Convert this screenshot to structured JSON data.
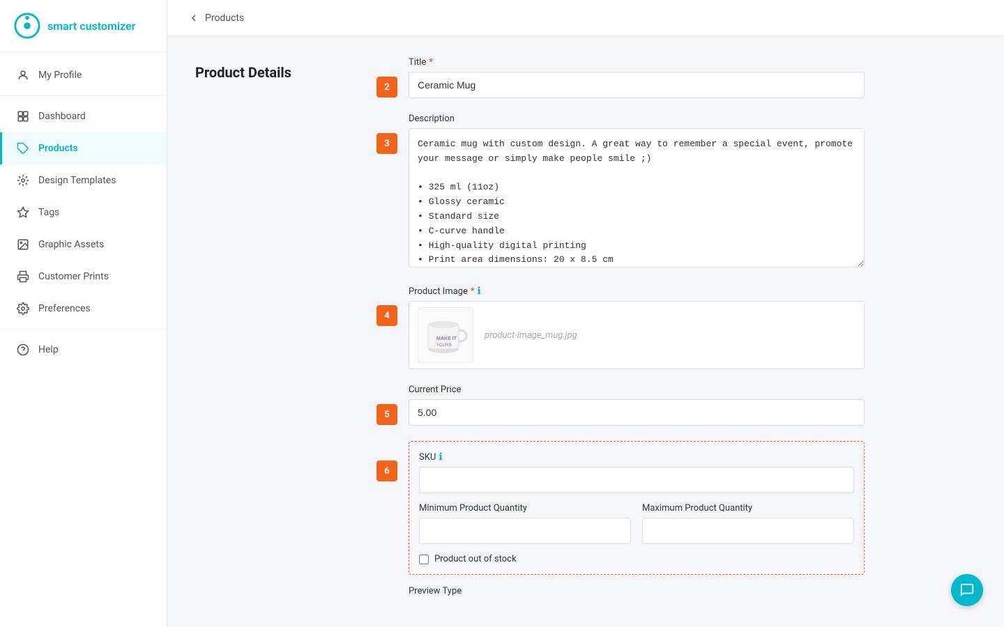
{
  "app": {
    "name": "smart customizer",
    "logo_alt": "smart customizer logo"
  },
  "sidebar": {
    "items": [
      {
        "id": "my-profile",
        "label": "My Profile",
        "icon": "user-icon",
        "active": false
      },
      {
        "id": "dashboard",
        "label": "Dashboard",
        "icon": "dashboard-icon",
        "active": false
      },
      {
        "id": "products",
        "label": "Products",
        "icon": "tag-icon",
        "active": true
      },
      {
        "id": "design-templates",
        "label": "Design Templates",
        "icon": "design-icon",
        "active": false
      },
      {
        "id": "tags",
        "label": "Tags",
        "icon": "tags-icon",
        "active": false
      },
      {
        "id": "graphic-assets",
        "label": "Graphic Assets",
        "icon": "graphic-icon",
        "active": false
      },
      {
        "id": "customer-prints",
        "label": "Customer Prints",
        "icon": "print-icon",
        "active": false
      },
      {
        "id": "preferences",
        "label": "Preferences",
        "icon": "gear-icon",
        "active": false
      },
      {
        "id": "help",
        "label": "Help",
        "icon": "help-icon",
        "active": false
      }
    ]
  },
  "breadcrumb": {
    "back_label": "Products"
  },
  "page": {
    "section_title": "Product Details"
  },
  "form": {
    "steps": [
      {
        "number": "2",
        "fields": [
          {
            "id": "title",
            "label": "Title",
            "required": true,
            "type": "input",
            "value": "Ceramic Mug"
          }
        ]
      },
      {
        "number": "3",
        "fields": [
          {
            "id": "description",
            "label": "Description",
            "required": false,
            "type": "textarea",
            "value": "Ceramic mug with custom design. A great way to remember a special event, promote your message or simply make people smile ;)\n\n• 325 ml (11oz)\n• Glossy ceramic\n• Standard size\n• C-curve handle\n• High-quality digital printing\n• Print area dimensions: 20 x 8.5 cm"
          }
        ]
      },
      {
        "number": "4",
        "fields": [
          {
            "id": "product-image",
            "label": "Product Image",
            "required": true,
            "info": true,
            "type": "image",
            "filename": "product-image_mug.jpg"
          }
        ]
      },
      {
        "number": "5",
        "fields": [
          {
            "id": "current-price",
            "label": "Current Price",
            "required": false,
            "type": "input",
            "value": "5.00"
          }
        ]
      },
      {
        "number": "6",
        "fields": [
          {
            "id": "sku",
            "label": "SKU",
            "required": false,
            "info": true,
            "type": "input",
            "value": ""
          },
          {
            "id": "min-qty",
            "label": "Minimum Product Quantity",
            "type": "input",
            "value": ""
          },
          {
            "id": "max-qty",
            "label": "Maximum Product Quantity",
            "type": "input",
            "value": ""
          },
          {
            "id": "out-of-stock",
            "label": "Product out of stock",
            "type": "checkbox",
            "checked": false
          }
        ]
      }
    ],
    "preview_type_label": "Preview Type"
  }
}
